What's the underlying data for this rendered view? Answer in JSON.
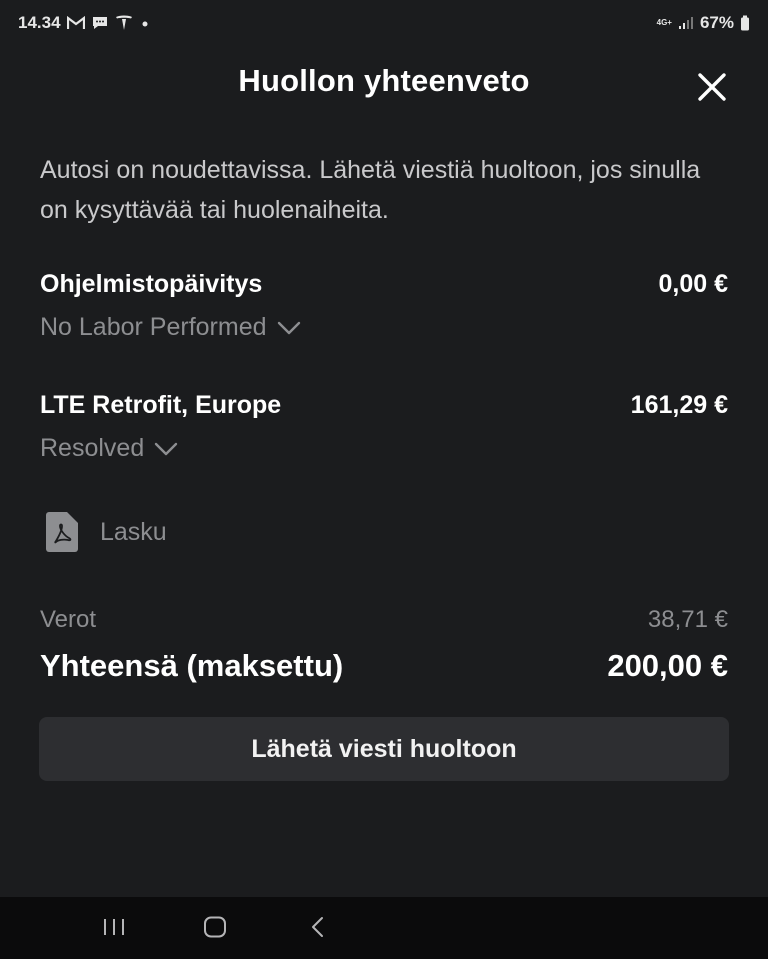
{
  "status_bar": {
    "time": "14.34",
    "network": "4G+",
    "battery": "67%"
  },
  "header": {
    "title": "Huollon yhteenveto",
    "close_icon": "close-icon"
  },
  "intro_text": "Autosi on noudettavissa. Lähetä viestiä huoltoon, jos sinulla on kysyttävää tai huolenaiheita.",
  "items": [
    {
      "name": "Ohjelmistopäivitys",
      "price": "0,00 €",
      "status": "No Labor Performed"
    },
    {
      "name": "LTE Retrofit, Europe",
      "price": "161,29 €",
      "status": "Resolved"
    }
  ],
  "invoice": {
    "label": "Lasku",
    "icon": "pdf-icon"
  },
  "summary": {
    "tax_label": "Verot",
    "tax_value": "38,71 €",
    "total_label": "Yhteensä (maksettu)",
    "total_value": "200,00 €"
  },
  "actions": {
    "message_button": "Lähetä viesti huoltoon"
  },
  "colors": {
    "background": "#1b1c1e",
    "button": "#2d2e31",
    "muted_text": "#8d8e91",
    "nav_bar": "#0b0b0c"
  }
}
